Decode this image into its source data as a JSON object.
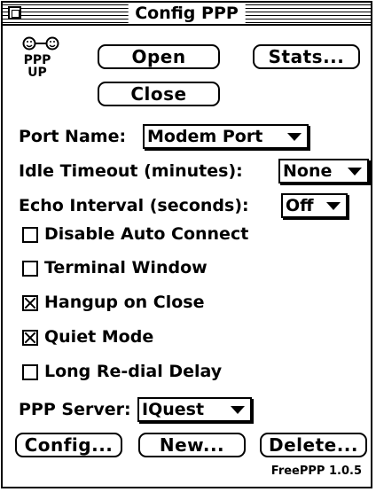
{
  "window": {
    "title": "Config PPP"
  },
  "status": {
    "line1": "PPP",
    "line2": "UP"
  },
  "buttons": {
    "open": "Open",
    "stats": "Stats...",
    "close": "Close",
    "config": "Config...",
    "new": "New...",
    "delete": "Delete..."
  },
  "port": {
    "label": "Port Name:",
    "value": "Modem Port"
  },
  "idle": {
    "label": "Idle Timeout (minutes):",
    "value": "None"
  },
  "echo": {
    "label": "Echo Interval (seconds):",
    "value": "Off"
  },
  "options": [
    {
      "label": "Disable Auto Connect",
      "checked": false
    },
    {
      "label": "Terminal Window",
      "checked": false
    },
    {
      "label": "Hangup on Close",
      "checked": true
    },
    {
      "label": "Quiet Mode",
      "checked": true
    },
    {
      "label": "Long Re-dial Delay",
      "checked": false
    }
  ],
  "server": {
    "label": "PPP Server:",
    "value": "IQuest"
  },
  "footer": {
    "version": "FreePPP 1.0.5"
  }
}
